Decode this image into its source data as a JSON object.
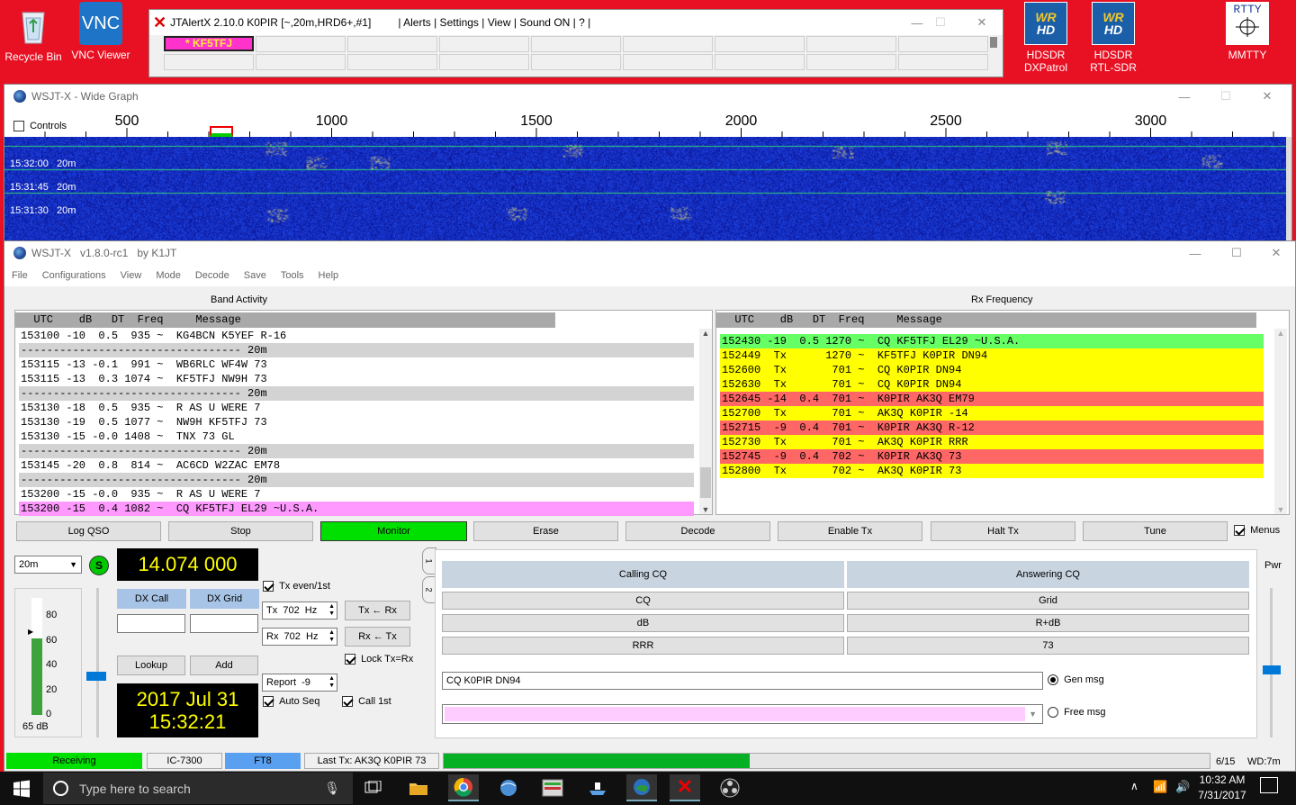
{
  "desktop": {
    "recycle_bin": "Recycle Bin",
    "vnc_viewer": "VNC Viewer",
    "hdsdr1_l1": "HDSDR",
    "hdsdr1_l2": "DXPatrol",
    "hdsdr2_l1": "HDSDR",
    "hdsdr2_l2": "RTL-SDR",
    "mmtty": "MMTTY",
    "vnc_glyph": "VNC",
    "rtty_glyph": "RTTY",
    "wr": "WR",
    "hd": "HD"
  },
  "jtalert": {
    "title": "JTAlertX 2.10.0 K0PIR [~,20m,HRD6+,#1]",
    "menu": "| Alerts | Settings | View | Sound ON | ? |",
    "callsign": "* KF5TFJ"
  },
  "wide_graph": {
    "title": "WSJT-X - Wide Graph",
    "controls_label": "Controls",
    "freq_labels": [
      "500",
      "1000",
      "1500",
      "2000",
      "2500",
      "3000"
    ],
    "time_labels": [
      "15:32:00   20m",
      "15:31:45   20m",
      "15:31:30   20m"
    ]
  },
  "main": {
    "title": "WSJT-X   v1.8.0-rc1   by K1JT",
    "menu": [
      "File",
      "Configurations",
      "View",
      "Mode",
      "Decode",
      "Save",
      "Tools",
      "Help"
    ],
    "band_activity_label": "Band Activity",
    "rx_frequency_label": "Rx Frequency",
    "band_header": "  UTC    dB   DT  Freq     Message",
    "rx_header": "  UTC    dB   DT  Freq     Message",
    "band_rows": [
      {
        "text": "153100 -10  0.5  935 ~  KG4BCN K5YEF R-16",
        "kind": "normal"
      },
      {
        "text": "---------------------------------- 20m",
        "kind": "sep"
      },
      {
        "text": "153115 -13 -0.1  991 ~  WB6RLC WF4W 73",
        "kind": "normal"
      },
      {
        "text": "153115 -13  0.3 1074 ~  KF5TFJ NW9H 73",
        "kind": "normal"
      },
      {
        "text": "---------------------------------- 20m",
        "kind": "sep"
      },
      {
        "text": "153130 -18  0.5  935 ~  R AS U WERE 7",
        "kind": "normal"
      },
      {
        "text": "153130 -19  0.5 1077 ~  NW9H KF5TFJ 73",
        "kind": "normal"
      },
      {
        "text": "153130 -15 -0.0 1408 ~  TNX 73 GL",
        "kind": "normal"
      },
      {
        "text": "---------------------------------- 20m",
        "kind": "sep"
      },
      {
        "text": "153145 -20  0.8  814 ~  AC6CD W2ZAC EM78",
        "kind": "normal"
      },
      {
        "text": "---------------------------------- 20m",
        "kind": "sep"
      },
      {
        "text": "153200 -15 -0.0  935 ~  R AS U WERE 7",
        "kind": "normal"
      },
      {
        "text": "153200 -15  0.4 1082 ~  CQ KF5TFJ EL29 ~U.S.A.",
        "kind": "cq"
      }
    ],
    "rx_rows": [
      {
        "text": "152430 -19  0.5 1270 ~  CQ KF5TFJ EL29 ~U.S.A.",
        "kind": "green"
      },
      {
        "text": "152449  Tx      1270 ~  KF5TFJ K0PIR DN94",
        "kind": "yellow"
      },
      {
        "text": "152600  Tx       701 ~  CQ K0PIR DN94",
        "kind": "yellow"
      },
      {
        "text": "152630  Tx       701 ~  CQ K0PIR DN94",
        "kind": "yellow"
      },
      {
        "text": "152645 -14  0.4  701 ~  K0PIR AK3Q EM79",
        "kind": "red"
      },
      {
        "text": "152700  Tx       701 ~  AK3Q K0PIR -14",
        "kind": "yellow"
      },
      {
        "text": "152715  -9  0.4  701 ~  K0PIR AK3Q R-12",
        "kind": "red"
      },
      {
        "text": "152730  Tx       701 ~  AK3Q K0PIR RRR",
        "kind": "yellow"
      },
      {
        "text": "152745  -9  0.4  702 ~  K0PIR AK3Q 73",
        "kind": "red"
      },
      {
        "text": "152800  Tx       702 ~  AK3Q K0PIR 73",
        "kind": "yellow"
      }
    ],
    "buttons": {
      "log_qso": "Log QSO",
      "stop": "Stop",
      "monitor": "Monitor",
      "erase": "Erase",
      "decode": "Decode",
      "enable_tx": "Enable Tx",
      "halt_tx": "Halt Tx",
      "tune": "Tune",
      "menus": "Menus"
    },
    "band_select": "20m",
    "s_meter": "S",
    "frequency": "14.074 000",
    "date": "2017 Jul 31",
    "time": "15:32:21",
    "meter_ticks": [
      "80",
      "60",
      "40",
      "20",
      "0"
    ],
    "meter_db": "65 dB",
    "meter_level": 0.65,
    "dx_call_label": "DX Call",
    "dx_grid_label": "DX Grid",
    "lookup": "Lookup",
    "add": "Add",
    "tx_even": "Tx even/1st",
    "tx_freq": "Tx  702  Hz",
    "rx_freq": "Rx  702  Hz",
    "tx_from_rx": "Tx ← Rx",
    "rx_from_tx": "Rx ← Tx",
    "lock_tx_rx": "Lock Tx=Rx",
    "report": "Report  -9",
    "auto_seq": "Auto Seq",
    "call_1st": "Call 1st",
    "tab1": "1",
    "tab2": "2",
    "calling_cq": "Calling CQ",
    "answering_cq": "Answering CQ",
    "macros_left": [
      "CQ",
      "dB",
      "RRR"
    ],
    "macros_right": [
      "Grid",
      "R+dB",
      "73"
    ],
    "gen_msg_value": "CQ K0PIR DN94",
    "gen_msg_label": "Gen msg",
    "free_msg_label": "Free msg",
    "pwr": "Pwr",
    "status": {
      "receiving": "Receiving",
      "rig": "IC-7300",
      "mode": "FT8",
      "last_tx": "Last Tx: AK3Q K0PIR 73",
      "progress_text": "6/15",
      "progress": 0.4,
      "wd": "WD:7m"
    }
  },
  "taskbar": {
    "search_placeholder": "Type here to search",
    "time": "10:32 AM",
    "date": "7/31/2017"
  }
}
